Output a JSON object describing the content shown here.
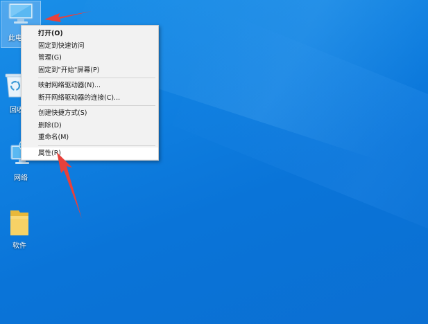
{
  "desktop": {
    "icons": [
      {
        "label": "此电",
        "icon": "computer-icon"
      },
      {
        "label": "回收",
        "icon": "recycle-bin-icon"
      },
      {
        "label": "网络",
        "icon": "network-icon"
      },
      {
        "label": "软件",
        "icon": "folder-icon"
      }
    ]
  },
  "context_menu": {
    "items": [
      {
        "label": "打开(O)",
        "bold": true
      },
      {
        "label": "固定到快速访问"
      },
      {
        "label": "管理(G)"
      },
      {
        "label": "固定到\"开始\"屏幕(P)"
      },
      {
        "label": "映射网络驱动器(N)..."
      },
      {
        "label": "断开网络驱动器的连接(C)..."
      },
      {
        "label": "创建快捷方式(S)"
      },
      {
        "label": "删除(D)"
      },
      {
        "label": "重命名(M)"
      },
      {
        "label": "属性(R)",
        "highlighted": true
      }
    ]
  },
  "colors": {
    "desktop_bg": "#0f7fe0",
    "menu_bg": "#f2f2f2",
    "annotation_arrow": "#e8413b"
  }
}
